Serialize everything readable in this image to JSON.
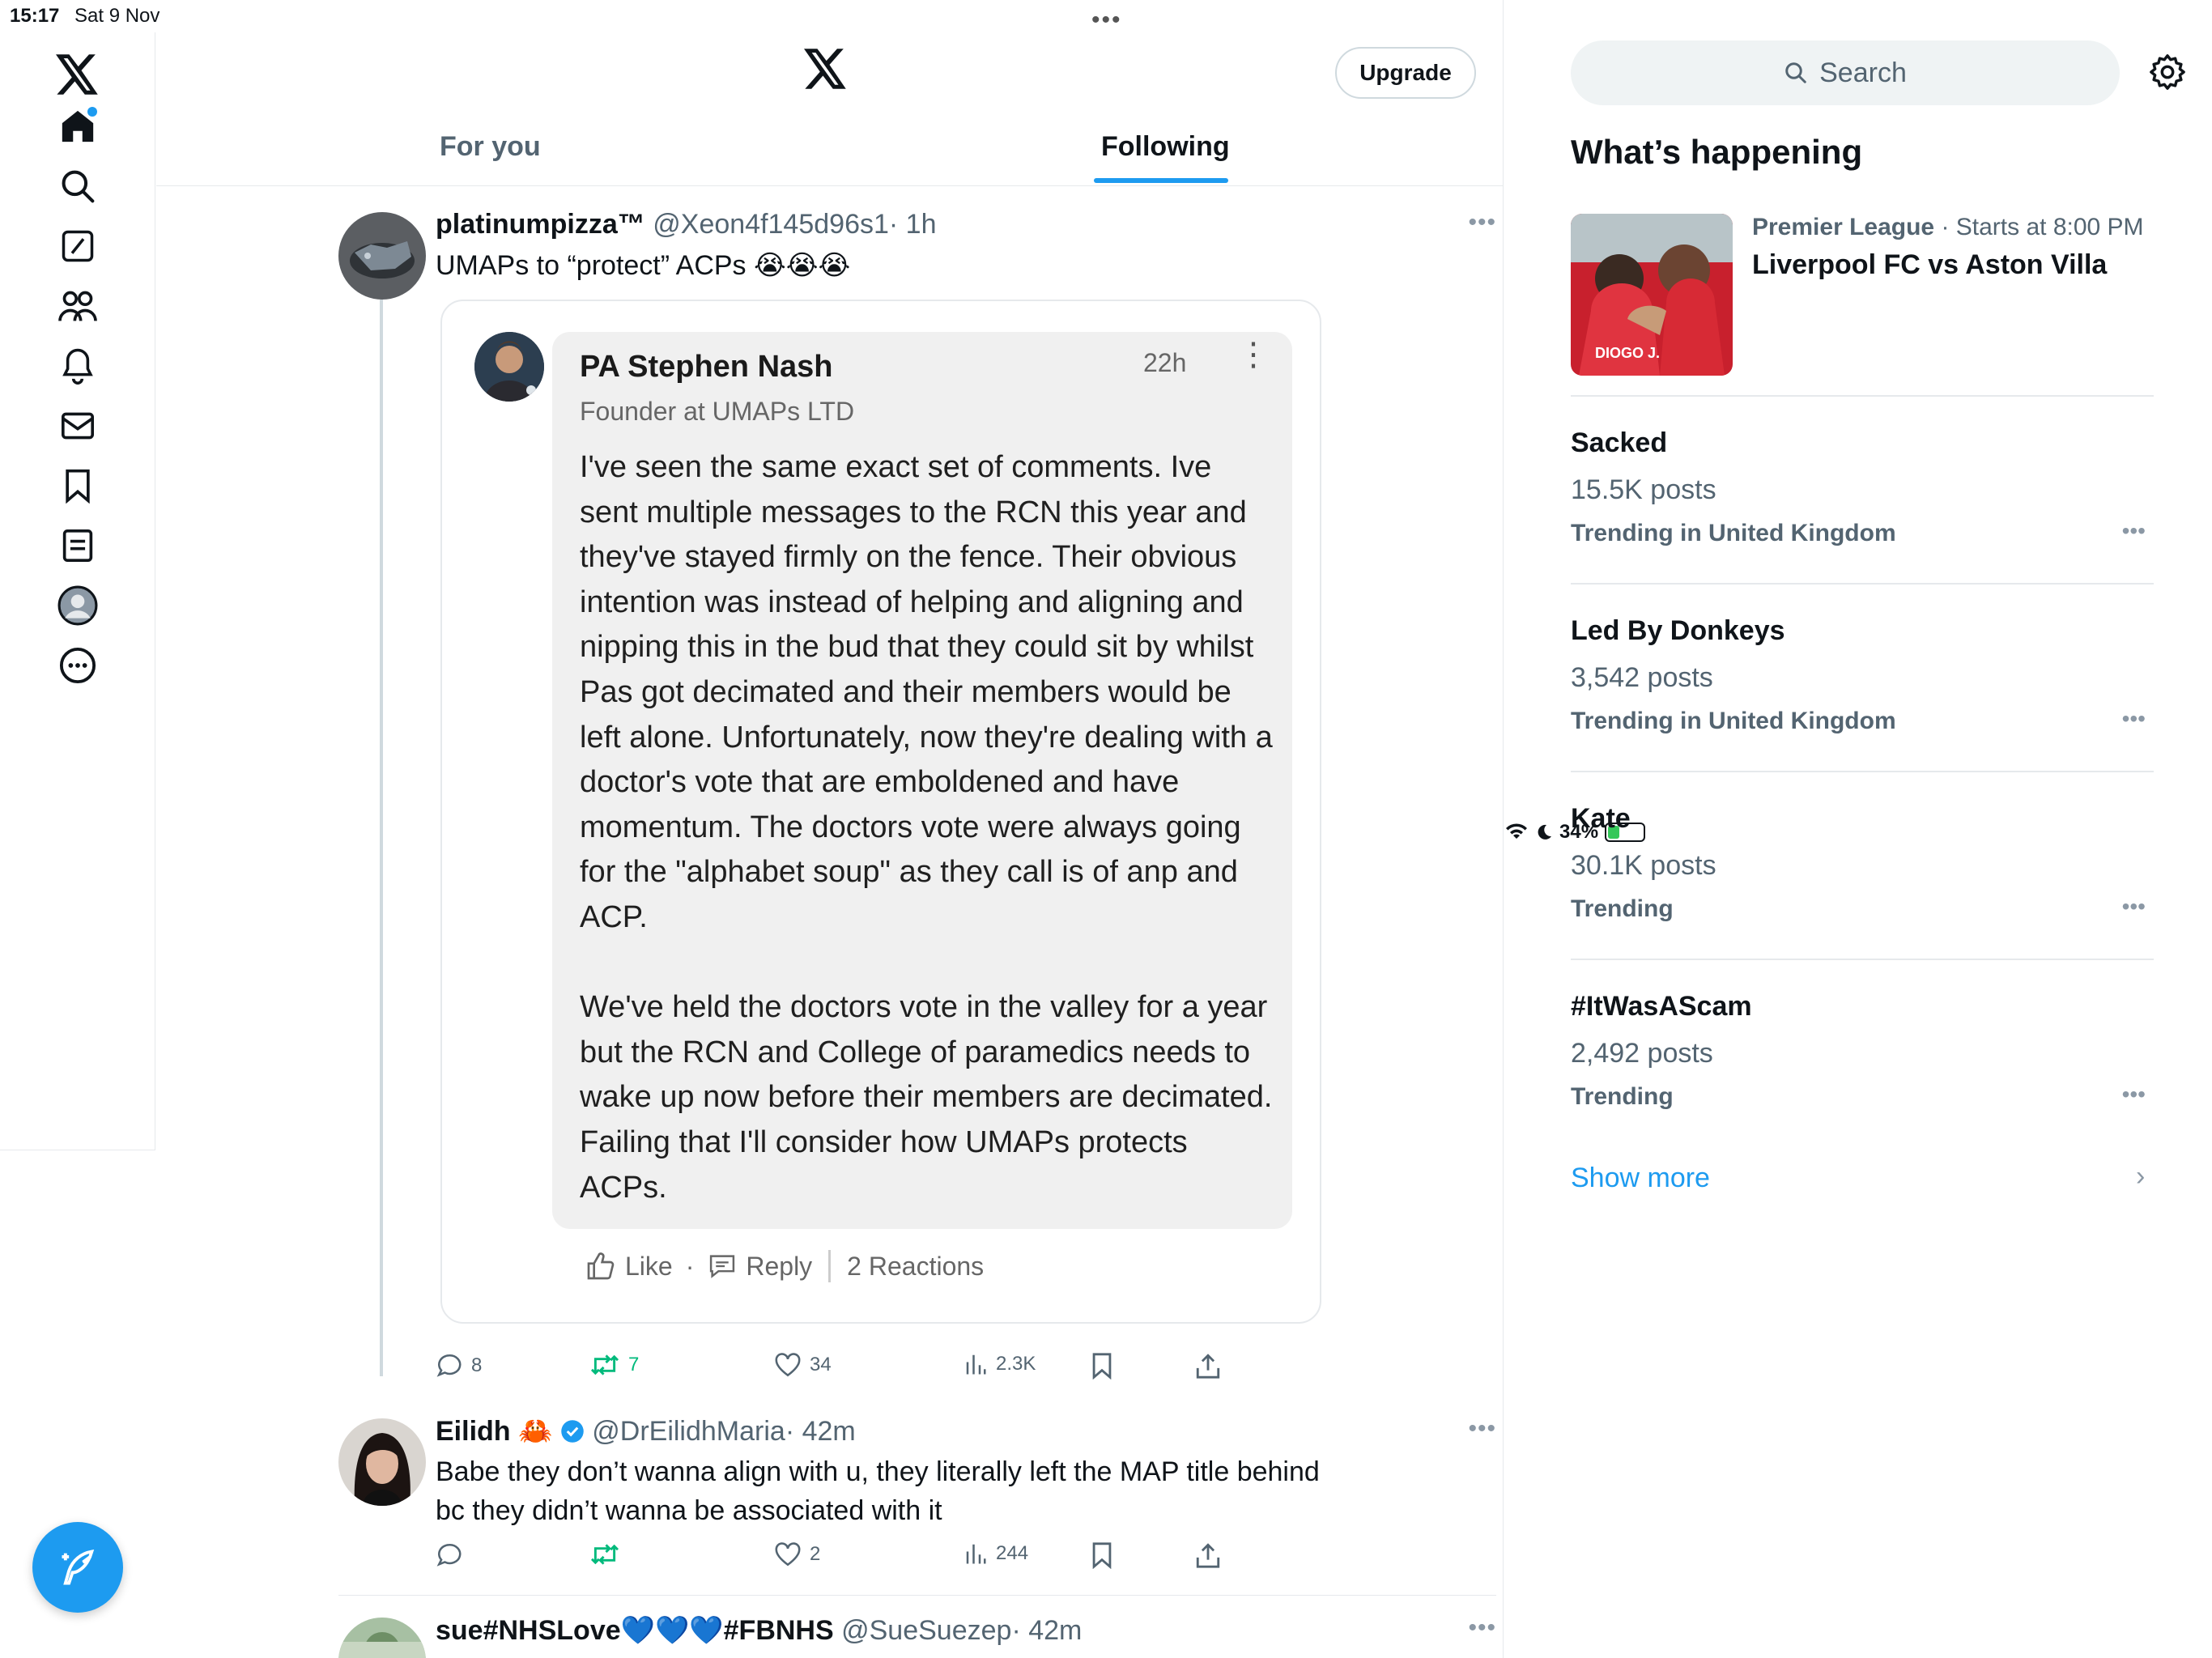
{
  "status_bar": {
    "time": "15:17",
    "date": "Sat 9 Nov",
    "battery": "34%",
    "battery_level": 0.34
  },
  "nav": {
    "items": [
      "x-logo",
      "home-icon",
      "search-icon",
      "grok-icon",
      "communities-icon",
      "notifications-icon",
      "messages-icon",
      "bookmarks-icon",
      "lists-icon",
      "profile-icon",
      "more-icon"
    ],
    "compose": "compose-icon"
  },
  "header": {
    "upgrade_label": "Upgrade",
    "tabs": [
      {
        "label": "For you",
        "active": false
      },
      {
        "label": "Following",
        "active": true
      }
    ]
  },
  "tweets": [
    {
      "name": "platinumpizza™",
      "handle": "@Xeon4f145d96s1",
      "time": "· 1h",
      "text": "UMAPs to “protect” ACPs 😭😭😭",
      "quoted": {
        "name": "PA Stephen Nash",
        "time": "22h",
        "subtitle": "Founder at UMAPs LTD",
        "body_p1": "I've seen the same exact set of comments. Ive sent multiple messages to the RCN this year and they've stayed firmly on the fence. Their obvious intention was instead of helping and aligning and nipping this in the bud that they could sit by whilst Pas got decimated and their members would be left alone. Unfortunately, now they're dealing with a doctor's vote that are emboldened and have momentum. The doctors vote were always going for the \"alphabet soup\" as they call is of anp and ACP.",
        "body_p2": "We've held the doctors vote in the valley for a year but the RCN and College of paramedics needs to wake up now before their members are decimated. Failing that I'll consider how UMAPs protects ACPs.",
        "like_label": "Like",
        "dot": "·",
        "reply_label": "Reply",
        "reactions_label": "2 Reactions"
      },
      "replies": "8",
      "reposts": "7",
      "likes": "34",
      "views": "2.3K"
    },
    {
      "name": "Eilidh 🦀",
      "handle": "@DrEilidhMaria",
      "time": "· 42m",
      "text": "Babe they don’t wanna align with u, they literally left the MAP title behind bc they didn’t wanna be associated with it",
      "replies": "",
      "reposts": "",
      "likes": "2",
      "views": "244"
    },
    {
      "name": "sue#NHSLove💙💙💙#FBNHS",
      "handle": "@SueSuezep",
      "time": "· 42m"
    }
  ],
  "sidebar": {
    "search_placeholder": "Search",
    "section_title": "What’s happening",
    "event": {
      "category": "Premier League",
      "meta": " · Starts at 8:00 PM",
      "title": "Liverpool FC vs Aston Villa",
      "thumb_label": "DIOGO J."
    },
    "trends": [
      {
        "name": "Sacked",
        "count": "15.5K posts",
        "context": "Trending in United Kingdom"
      },
      {
        "name": "Led By Donkeys",
        "count": "3,542 posts",
        "context": "Trending in United Kingdom"
      },
      {
        "name": "Kate",
        "count": "30.1K posts",
        "context": "Trending"
      },
      {
        "name": "#ItWasAScam",
        "count": "2,492 posts",
        "context": "Trending"
      }
    ],
    "show_more": "Show more"
  },
  "colors": {
    "accent": "#1d9bf0",
    "repost_green": "#00ba7c",
    "text_secondary": "#536471",
    "border": "#e6e9ec",
    "verified": "#1d9bf0"
  }
}
